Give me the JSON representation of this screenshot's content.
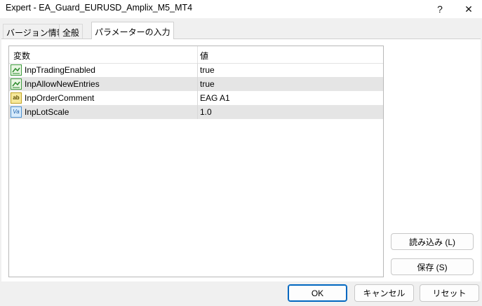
{
  "window": {
    "title": "Expert - EA_Guard_EURUSD_Amplix_M5_MT4",
    "help_label": "?",
    "close_label": "✕"
  },
  "tabs": [
    {
      "label": "バージョン情報"
    },
    {
      "label": "全般"
    },
    {
      "label": "パラメーターの入力"
    }
  ],
  "grid": {
    "columns": {
      "variable": "変数",
      "value": "値"
    },
    "rows": [
      {
        "icon": "boolean-icon",
        "name": "InpTradingEnabled",
        "value": "true"
      },
      {
        "icon": "boolean-icon",
        "name": "InpAllowNewEntries",
        "value": "true"
      },
      {
        "icon": "string-icon",
        "icon_text": "ab",
        "name": "InpOrderComment",
        "value": "EAG A1"
      },
      {
        "icon": "number-icon",
        "icon_text": "Va",
        "name": "InpLotScale",
        "value": "1.0"
      }
    ]
  },
  "side_buttons": {
    "load": "読み込み (L)",
    "save": "保存 (S)"
  },
  "footer_buttons": {
    "ok": "OK",
    "cancel": "キャンセル",
    "reset": "リセット"
  },
  "colors": {
    "accent": "#0067c0",
    "alt_row": "#e5e5e5"
  }
}
